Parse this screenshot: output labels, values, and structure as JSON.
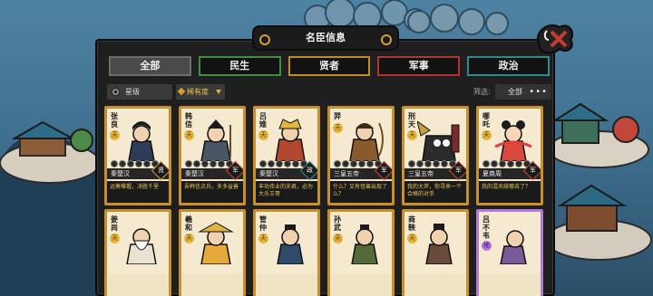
{
  "panel": {
    "title": "名臣信息"
  },
  "tabs": [
    {
      "label": "全部",
      "active": true
    },
    {
      "label": "民生",
      "active": false
    },
    {
      "label": "贤者",
      "active": false
    },
    {
      "label": "军事",
      "active": false
    },
    {
      "label": "政治",
      "active": false
    }
  ],
  "filter": {
    "star_label": "星级",
    "rarity_label": "稀有度",
    "filter_label": "筛选:",
    "filter_value": "全部",
    "more": "•••"
  },
  "colors": {
    "gold_border": "#c8902a",
    "purple_border": "#b07ad8",
    "quote_text": "#f0c850"
  },
  "cards": [
    {
      "name": "张良",
      "rarity": "天",
      "dynasty": "秦楚汉",
      "category": "贤",
      "quote": "运筹帷幄，决胜千里"
    },
    {
      "name": "韩信",
      "rarity": "天",
      "dynasty": "秦楚汉",
      "category": "军",
      "quote": "吾韩信点兵，多多益善"
    },
    {
      "name": "吕雉",
      "rarity": "天",
      "dynasty": "秦楚汉",
      "category": "政",
      "quote": "丰功伟业的夫君，必为大乐王哥"
    },
    {
      "name": "羿",
      "rarity": "天",
      "dynasty": "三皇五帝",
      "category": "军",
      "quote": "什么？又有怪兽出现了么？"
    },
    {
      "name": "刑天",
      "rarity": "天",
      "dynasty": "三皇五帝",
      "category": "军",
      "quote": "我的大斧，你寻来一个合格的对手"
    },
    {
      "name": "哪吒",
      "rarity": "天",
      "dynasty": "夏商周",
      "category": "军",
      "quote": "我的混天绫哪去了？"
    },
    {
      "name": "姜尚",
      "rarity": "天",
      "dynasty": "",
      "category": "",
      "quote": ""
    },
    {
      "name": "羲和",
      "rarity": "天",
      "dynasty": "",
      "category": "",
      "quote": ""
    },
    {
      "name": "管仲",
      "rarity": "天",
      "dynasty": "",
      "category": "",
      "quote": ""
    },
    {
      "name": "孙武",
      "rarity": "天",
      "dynasty": "",
      "category": "",
      "quote": ""
    },
    {
      "name": "商鞅",
      "rarity": "天",
      "dynasty": "",
      "category": "",
      "quote": ""
    },
    {
      "name": "吕不韦",
      "rarity": "地",
      "dynasty": "",
      "category": "",
      "quote": ""
    }
  ]
}
